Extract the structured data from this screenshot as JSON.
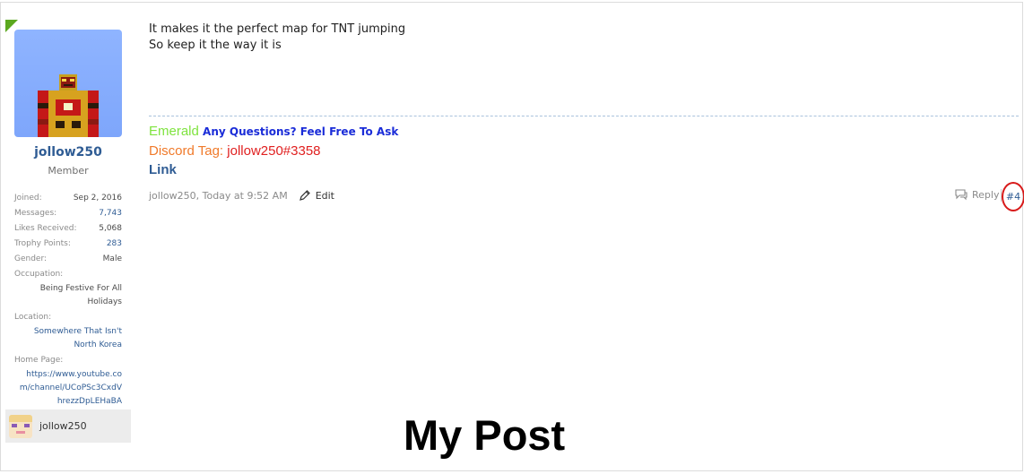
{
  "user": {
    "name": "jollow250",
    "title": "Member",
    "extra": [
      {
        "key": "Joined:",
        "value": "Sep 2, 2016",
        "link": false
      },
      {
        "key": "Messages:",
        "value": "7,743",
        "link": true
      },
      {
        "key": "Likes Received:",
        "value": "5,068",
        "link": false
      },
      {
        "key": "Trophy Points:",
        "value": "283",
        "link": true
      },
      {
        "key": "Gender:",
        "value": "Male",
        "link": false
      }
    ],
    "occupation_label": "Occupation:",
    "occupation_lines": [
      "Being Festive For All",
      "Holidays"
    ],
    "location_label": "Location:",
    "location_lines": [
      "Somewhere That Isn't",
      "North Korea"
    ],
    "homepage_label": "Home Page:",
    "homepage_lines": [
      "https://www.youtube.co",
      "m/channel/UCoPSc3CxdV",
      "hrezzDpLEHaBA"
    ],
    "mini_name": "jollow250"
  },
  "message": {
    "lines": [
      "It makes it the perfect map for TNT jumping",
      "So keep it the way it is"
    ]
  },
  "signature": {
    "emerald": "Emerald",
    "ask": "Any Questions? Feel Free To Ask",
    "discord_label": "Discord Tag:",
    "discord_value": "jollow250#3358",
    "link": "Link"
  },
  "meta": {
    "author_time": "jollow250, Today at 9:52 AM",
    "edit_label": "Edit",
    "reply_label": "Reply",
    "post_number": "#4"
  },
  "annotation": "My Post",
  "colors": {
    "accent_link": "#2f5c94",
    "emerald": "#7fe33f",
    "ask": "#1a2cd8",
    "discord_label": "#f07a2a",
    "discord_value": "#e02020",
    "highlight_circle": "#d81a1a"
  },
  "icons": [
    "pencil-icon",
    "speech-bubble-icon"
  ]
}
